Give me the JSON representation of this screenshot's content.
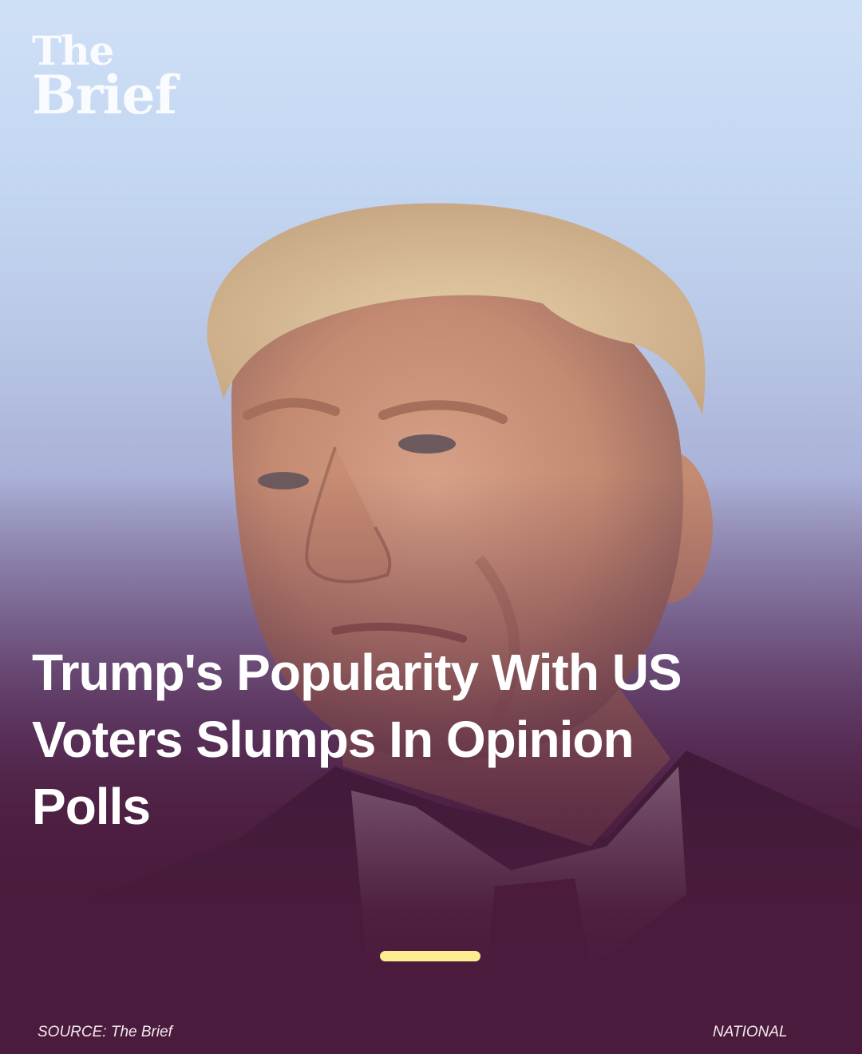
{
  "brand": {
    "line1": "The",
    "line2": "Brief"
  },
  "article": {
    "headline": "Trump's Popularity With US Voters Slumps In Opinion Polls"
  },
  "carousel": {
    "active_index": 1,
    "total": 1
  },
  "footer": {
    "source": "SOURCE: The Brief",
    "category": "NATIONAL"
  },
  "colors": {
    "background": "#4a1b3c",
    "indicator": "#fbec8f",
    "headline": "#ffffff"
  },
  "icons": {
    "photo": "man-portrait-photo"
  }
}
